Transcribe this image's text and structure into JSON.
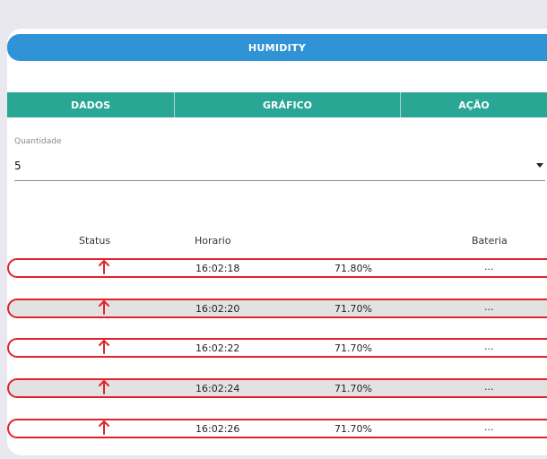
{
  "header": {
    "title": "HUMIDITY"
  },
  "tabs": [
    {
      "label": "DADOS"
    },
    {
      "label": "GRÁFICO"
    },
    {
      "label": "AÇÃO"
    }
  ],
  "quantity": {
    "label": "Quantidade",
    "value": "5"
  },
  "table": {
    "columns": {
      "status": "Status",
      "time": "Horario",
      "battery": "Bateria"
    },
    "rows": [
      {
        "status": "up",
        "time": "16:02:18",
        "value": "71.80%",
        "battery": "..."
      },
      {
        "status": "up",
        "time": "16:02:20",
        "value": "71.70%",
        "battery": "..."
      },
      {
        "status": "up",
        "time": "16:02:22",
        "value": "71.70%",
        "battery": "..."
      },
      {
        "status": "up",
        "time": "16:02:24",
        "value": "71.70%",
        "battery": "..."
      },
      {
        "status": "up",
        "time": "16:02:26",
        "value": "71.70%",
        "battery": "..."
      }
    ]
  },
  "colors": {
    "header": "#2f93d6",
    "tab": "#2aa695",
    "row_border": "#e2222a",
    "status_icon": "#e2222a",
    "row_alt_bg": "#e2e2e2"
  }
}
